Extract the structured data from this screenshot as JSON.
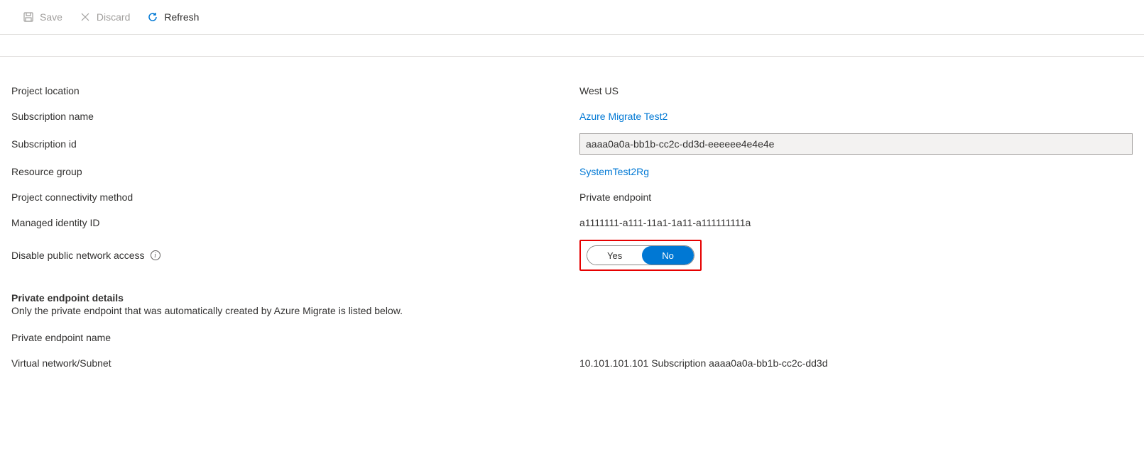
{
  "toolbar": {
    "save_label": "Save",
    "discard_label": "Discard",
    "refresh_label": "Refresh"
  },
  "labels": {
    "project_location": "Project location",
    "subscription_name": "Subscription name",
    "subscription_id": "Subscription id",
    "resource_group": "Resource group",
    "connectivity_method": "Project connectivity method",
    "managed_identity_id": "Managed identity ID",
    "disable_public_access": "Disable public network access",
    "private_endpoint_details": "Private endpoint details",
    "private_endpoint_note": "Only the private endpoint that was automatically created by Azure Migrate is listed below.",
    "private_endpoint_name": "Private endpoint name",
    "vnet_subnet": "Virtual network/Subnet"
  },
  "values": {
    "project_location": "West US",
    "subscription_name": "Azure Migrate Test2",
    "subscription_id": "aaaa0a0a-bb1b-cc2c-dd3d-eeeeee4e4e4e",
    "resource_group": "SystemTest2Rg",
    "connectivity_method": "Private endpoint",
    "managed_identity_id": "a1111111-a111-11a1-1a11-a111111111a",
    "vnet_subnet": "10.101.101.101 Subscription aaaa0a0a-bb1b-cc2c-dd3d"
  },
  "toggle": {
    "yes": "Yes",
    "no": "No",
    "selected": "No"
  }
}
